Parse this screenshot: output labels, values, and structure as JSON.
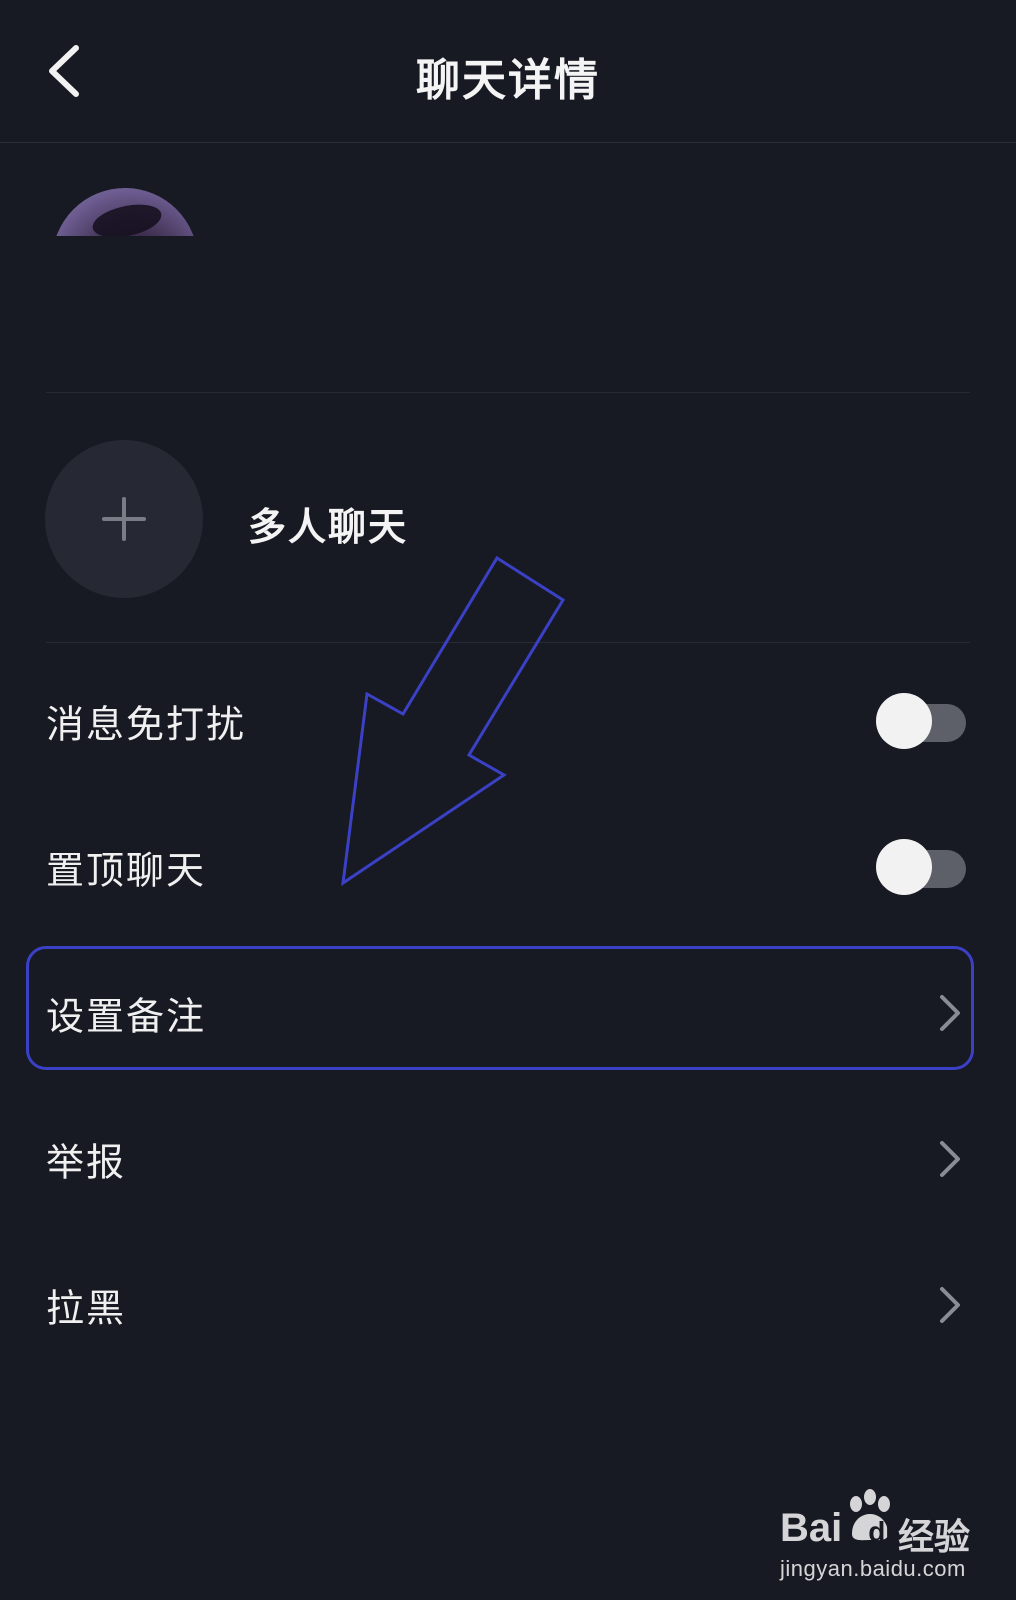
{
  "header": {
    "title": "聊天详情",
    "back_icon": "chevron-left-icon"
  },
  "members": {
    "avatar_icon": "user-avatar"
  },
  "add_member": {
    "icon": "plus-icon",
    "label": "多人聊天"
  },
  "settings": {
    "items": [
      {
        "label": "消息免打扰",
        "control": "toggle",
        "on": false
      },
      {
        "label": "置顶聊天",
        "control": "toggle",
        "on": false
      },
      {
        "label": "设置备注",
        "control": "chevron",
        "icon": "chevron-right-icon"
      },
      {
        "label": "举报",
        "control": "chevron",
        "icon": "chevron-right-icon"
      },
      {
        "label": "拉黑",
        "control": "chevron",
        "icon": "chevron-right-icon"
      }
    ]
  },
  "annotation": {
    "color": "#3b41c5",
    "target": "设置备注"
  },
  "watermark": {
    "brand_left": "Bai",
    "brand_right": "du",
    "suffix": "经验",
    "url": "jingyan.baidu.com"
  },
  "colors": {
    "background": "#171923",
    "text": "#f0f0f0",
    "toggle_track": "#5e6069",
    "toggle_knob": "#f2f2f2",
    "add_circle": "#262833",
    "chevron": "#8a8c94"
  }
}
